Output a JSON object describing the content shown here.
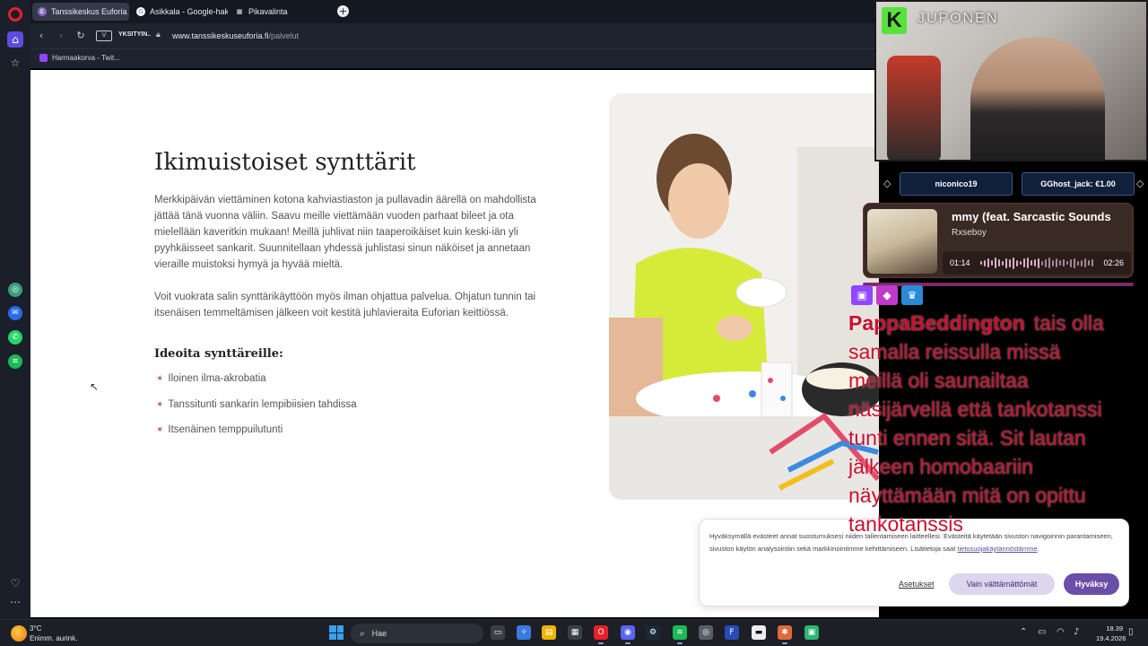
{
  "browser": {
    "tabs": [
      {
        "label": "Tanssikeskus Euforia - Pal"
      },
      {
        "label": "Asikkala - Google-haku"
      },
      {
        "label": "Pikavalinta"
      }
    ],
    "new_tab": "+",
    "address": {
      "vpn": "V",
      "private_label": "YKSITYIN..",
      "url_host": "www.tanssikeskuseuforia.fi",
      "url_path": "/palvelut"
    },
    "bookmarks": [
      {
        "label": "Harmaakorva - Twit..."
      }
    ]
  },
  "page": {
    "title": "Ikimuistoiset synttärit",
    "paragraph1": "Merkkipäivän viettäminen kotona kahviastiaston ja pullavadin äärellä on mahdollista jättää tänä vuonna väliin. Saavu meille viettämään vuoden parhaat bileet ja ota mielellään kaveritkin mukaan! Meillä juhlivat niin taaperoikäiset kuin keski-iän yli pyyhkäisseet sankarit. Suunnitellaan yhdessä juhlistasi sinun näköiset ja annetaan vieraille muistoksi hymyä ja hyvää mieltä.",
    "paragraph2": "Voit vuokrata salin synttärikäyttöön myös ilman ohjattua palvelua. Ohjatun tunnin tai itsenäisen temmeltämisen jälkeen voit kestitä juhlavieraita Euforian keittiössä.",
    "ideas_title": "Ideoita synttäreille:",
    "ideas": [
      {
        "label": "Iloinen ilma-akrobatia"
      },
      {
        "label": "Tanssitunti sankarin lempibiisien tahdissa"
      },
      {
        "label": "Itsenäinen temppuilutunti"
      }
    ]
  },
  "cookie": {
    "text": "Hyväksymällä evästeet annat suostumuksesi niiden tallentamiseen laitteellesi. Evästeitä käytetään sivuston navigoinnin parantamiseen, sivuston käytön analysointiin sekä markkinointimme kehittämiseen. Lisätietoja saat",
    "link": "tietosuojakäytännöstämme",
    "link_suffix": ".",
    "settings": "Asetukset",
    "necessary_only": "Vain välttämättömät",
    "accept": "Hyväksy"
  },
  "stream": {
    "channel_name": "JUPONEN",
    "channel_logo": "K",
    "donations": [
      {
        "label": "niconico19"
      },
      {
        "label": "GGhost_jack: €1.00"
      }
    ],
    "song": {
      "title": "mmy (feat. Sarcastic Sounds",
      "artist": "Rxseboy",
      "time_now": "01:14",
      "time_end": "02:26",
      "progress": 0.51
    },
    "chat": {
      "username": "PappaBeddington",
      "message": "tais olla samalla reissulla missä meillä oli saunailtaa näsijärvellä että tankotanssi tunti ennen sitä. Sit lautan jälkeen homobaariin näyttämään mitä on opittu tankotanssis"
    }
  },
  "taskbar": {
    "weather_temp": "3°C",
    "weather_desc": "Enimm. aurink.",
    "search_placeholder": "Hae",
    "time": "18.39",
    "date": "19.4.2026"
  },
  "colors": {
    "accent_purple": "#6a4ea8",
    "chat_red": "#c8102e",
    "opera_red": "#e7202b"
  }
}
